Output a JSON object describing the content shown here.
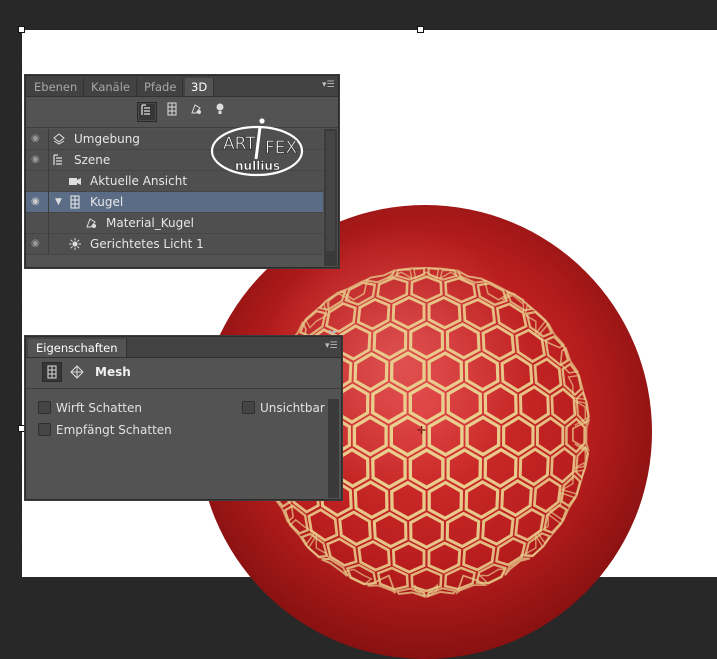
{
  "panel_3d": {
    "tabs": [
      "Ebenen",
      "Kanäle",
      "Pfade",
      "3D"
    ],
    "active_tab": "3D",
    "toolbar_icons": [
      "scene-tree-icon",
      "mesh-filter-icon",
      "material-filter-icon",
      "light-filter-icon"
    ],
    "items": [
      {
        "label": "Umgebung",
        "icon": "environment-icon"
      },
      {
        "label": "Szene",
        "icon": "scene-icon"
      },
      {
        "label": "Aktuelle Ansicht",
        "icon": "camera-icon"
      },
      {
        "label": "Kugel",
        "icon": "mesh-icon",
        "selected": true
      },
      {
        "label": "Material_Kugel",
        "icon": "material-icon"
      },
      {
        "label": "Gerichtetes Licht 1",
        "icon": "light-icon"
      }
    ]
  },
  "properties": {
    "tab": "Eigenschaften",
    "title": "Mesh",
    "checkboxes": {
      "wirft_schatten": "Wirft Schatten",
      "unsichtbar": "Unsichtbar",
      "empfaengt_schatten": "Empfängt Schatten"
    }
  },
  "watermark": {
    "line1": "ART",
    "line2": "FEX",
    "line3": "nullius"
  },
  "colors": {
    "panel_bg": "#535353",
    "selection": "#5b6d86",
    "sphere_red": "#c42424",
    "honeycomb_gold": "#e9cf8e"
  }
}
